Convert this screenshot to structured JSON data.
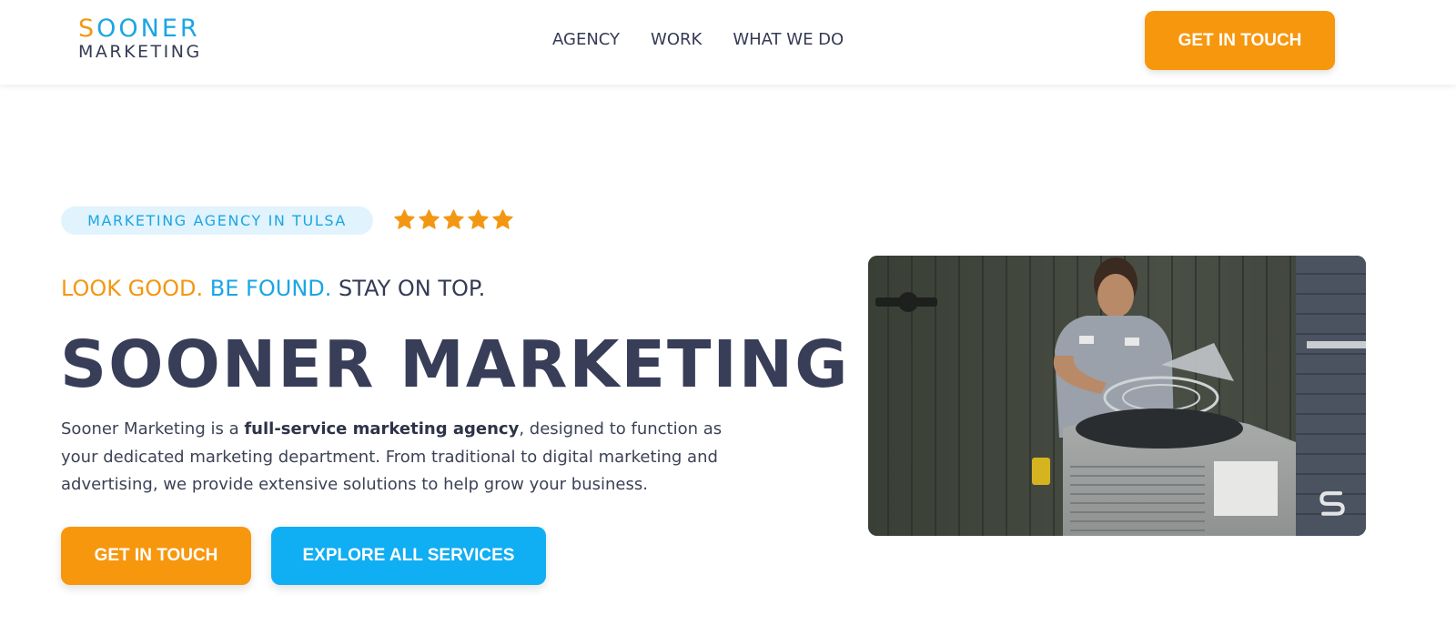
{
  "header": {
    "logo": {
      "top_first": "S",
      "top_rest": "OONER",
      "bottom": "MARKETING"
    },
    "nav": [
      {
        "label": "AGENCY"
      },
      {
        "label": "WORK"
      },
      {
        "label": "WHAT WE DO"
      }
    ],
    "cta_label": "GET IN TOUCH"
  },
  "hero": {
    "tag_label": "MARKETING AGENCY IN TULSA",
    "rating": {
      "stars": 5,
      "max": 5
    },
    "tagline": {
      "part1": "LOOK GOOD.",
      "part2": "BE FOUND.",
      "part3": "STAY ON TOP."
    },
    "title": "SOONER MARKETING",
    "description": {
      "before": "Sooner Marketing is a ",
      "bold": "full-service marketing agency",
      "after": ", designed to function as your dedicated marketing department. From traditional to digital marketing and advertising, we provide extensive solutions to help grow your business."
    },
    "buttons": {
      "primary": "GET IN TOUCH",
      "secondary": "EXPLORE ALL SERVICES"
    },
    "media_icon": "sooner-s-logo-icon"
  },
  "colors": {
    "orange": "#f7970e",
    "blue": "#10aef3",
    "navy": "#353b55",
    "tag_bg": "#e1f3fc"
  }
}
